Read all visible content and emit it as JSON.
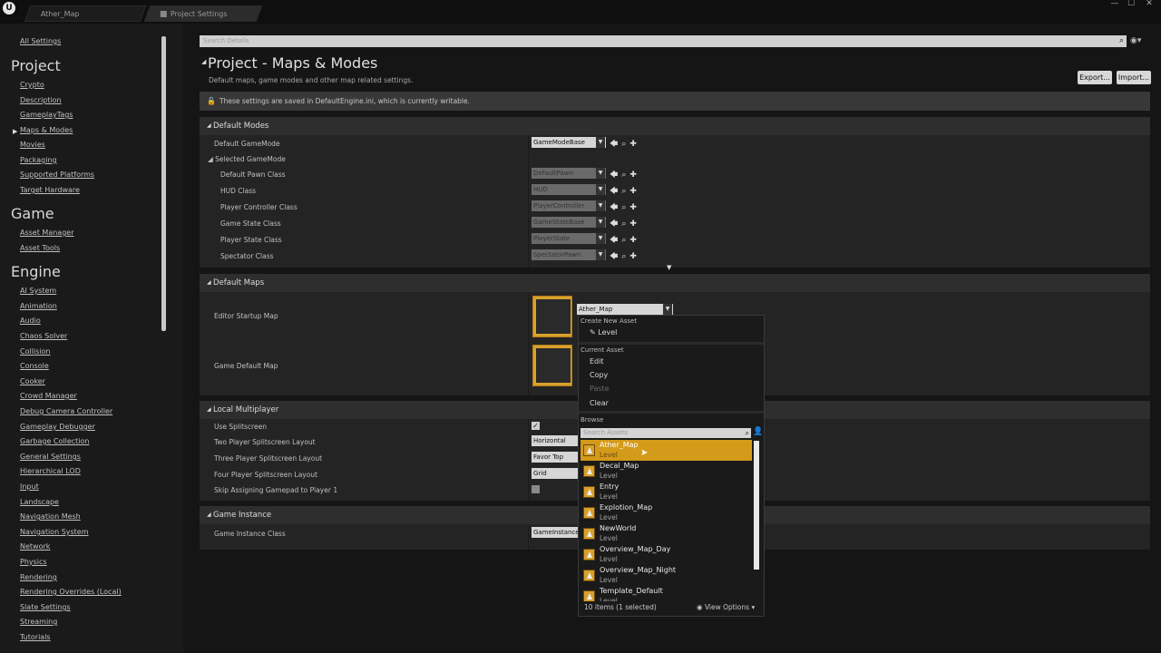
{
  "app": {
    "logo": "U"
  },
  "tabs": [
    {
      "label": "Ather_Map"
    },
    {
      "label": "Project Settings"
    }
  ],
  "window_buttons": {
    "minimize": "—",
    "maximize": "☐",
    "close": "✕"
  },
  "sidebar": {
    "all_settings": "All Settings",
    "sections": [
      {
        "title": "Project",
        "items": [
          "Crypto",
          "Description",
          "GameplayTags",
          "Maps & Modes",
          "Movies",
          "Packaging",
          "Supported Platforms",
          "Target Hardware"
        ]
      },
      {
        "title": "Game",
        "items": [
          "Asset Manager",
          "Asset Tools"
        ]
      },
      {
        "title": "Engine",
        "items": [
          "AI System",
          "Animation",
          "Audio",
          "Chaos Solver",
          "Collision",
          "Console",
          "Cooker",
          "Crowd Manager",
          "Debug Camera Controller",
          "Gameplay Debugger",
          "Garbage Collection",
          "General Settings",
          "Hierarchical LOD",
          "Input",
          "Landscape",
          "Navigation Mesh",
          "Navigation System",
          "Network",
          "Physics",
          "Rendering",
          "Rendering Overrides (Local)",
          "Slate Settings",
          "Streaming",
          "Tutorials"
        ]
      }
    ],
    "selected": "Maps & Modes"
  },
  "main": {
    "search_placeholder": "Search Details",
    "title": "Project - Maps & Modes",
    "description": "Default maps, game modes and other map related settings.",
    "export_label": "Export...",
    "import_label": "Import...",
    "info": "These settings are saved in DefaultEngine.ini, which is currently writable."
  },
  "default_modes": {
    "header": "Default Modes",
    "default_gamemode_label": "Default GameMode",
    "default_gamemode_value": "GameModeBase",
    "selected_gamemode_label": "Selected GameMode",
    "rows": [
      {
        "label": "Default Pawn Class",
        "value": "DefaultPawn"
      },
      {
        "label": "HUD Class",
        "value": "HUD"
      },
      {
        "label": "Player Controller Class",
        "value": "PlayerController"
      },
      {
        "label": "Game State Class",
        "value": "GameStateBase"
      },
      {
        "label": "Player State Class",
        "value": "PlayerState"
      },
      {
        "label": "Spectator Class",
        "value": "SpectatorPawn"
      }
    ]
  },
  "default_maps": {
    "header": "Default Maps",
    "editor_startup_label": "Editor Startup Map",
    "editor_startup_value": "Ather_Map",
    "game_default_label": "Game Default Map"
  },
  "local_multiplayer": {
    "header": "Local Multiplayer",
    "use_splitscreen_label": "Use Splitscreen",
    "use_splitscreen": true,
    "two_player_label": "Two Player Splitscreen Layout",
    "two_player_value": "Horizontal",
    "three_player_label": "Three Player Splitscreen Layout",
    "three_player_value": "Favor Top",
    "four_player_label": "Four Player Splitscreen Layout",
    "four_player_value": "Grid",
    "skip_gamepad_label": "Skip Assigning Gamepad to Player 1",
    "skip_gamepad": false
  },
  "game_instance": {
    "header": "Game Instance",
    "class_label": "Game Instance Class",
    "class_value": "GameInstance"
  },
  "dropdown": {
    "create_new_asset": "Create New Asset",
    "level_item": "Level",
    "current_asset": "Current Asset",
    "edit": "Edit",
    "copy": "Copy",
    "paste": "Paste",
    "clear": "Clear",
    "browse": "Browse",
    "search_placeholder": "Search Assets",
    "assets": [
      {
        "name": "Ather_Map",
        "type": "Level",
        "selected": true
      },
      {
        "name": "Decal_Map",
        "type": "Level"
      },
      {
        "name": "Entry",
        "type": "Level"
      },
      {
        "name": "Explotion_Map",
        "type": "Level"
      },
      {
        "name": "NewWorld",
        "type": "Level"
      },
      {
        "name": "Overview_Map_Day",
        "type": "Level"
      },
      {
        "name": "Overview_Map_Night",
        "type": "Level"
      },
      {
        "name": "Template_Default",
        "type": "Level"
      }
    ],
    "count": "10 items (1 selected)",
    "view_options": "View Options"
  },
  "colors": {
    "selection": "#d49a19",
    "background": "#151515",
    "panel": "#242424"
  }
}
